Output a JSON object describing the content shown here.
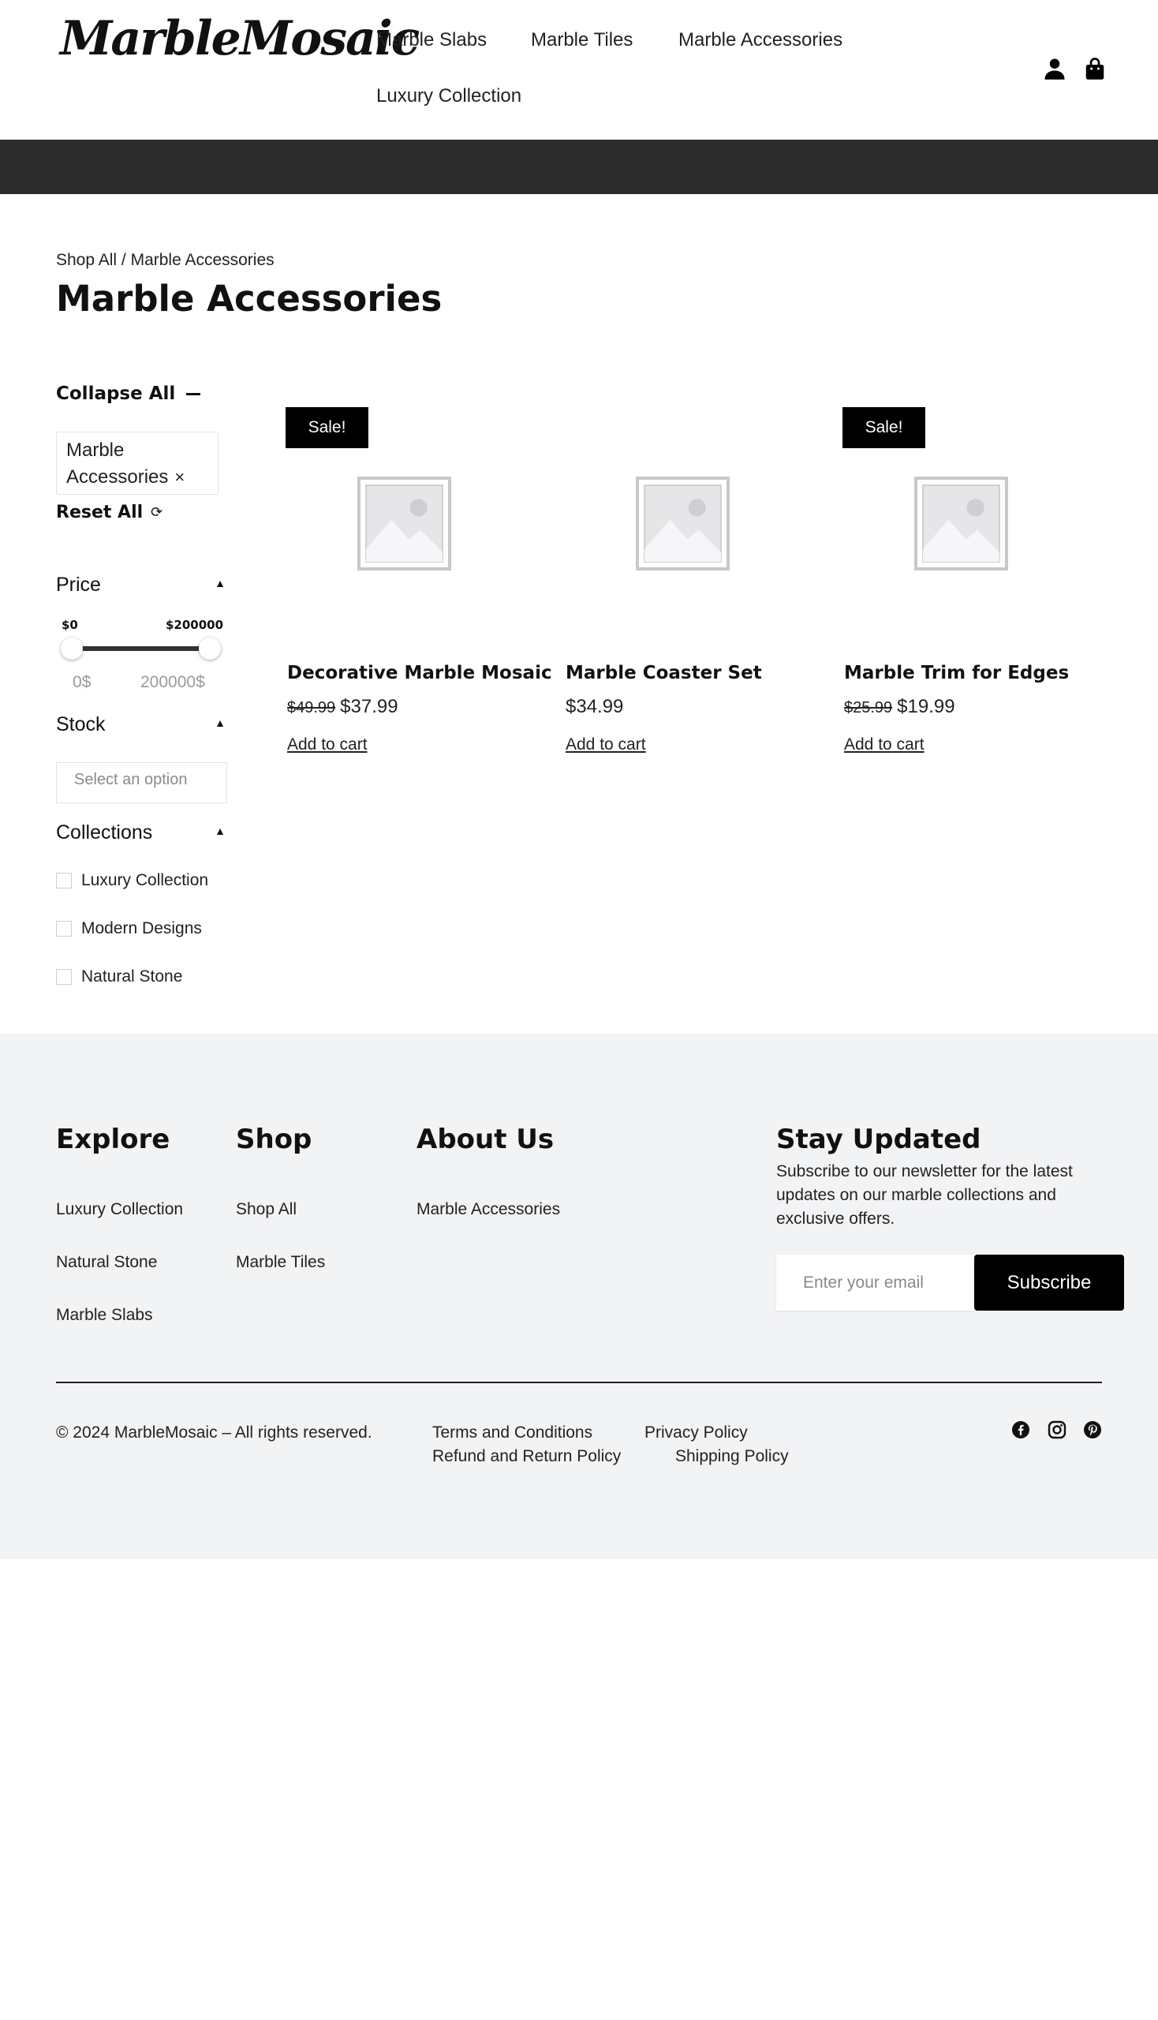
{
  "header": {
    "logo": "MarbleMosaic",
    "nav": [
      "Marble Slabs",
      "Marble Tiles",
      "Marble Accessories",
      "Luxury Collection"
    ],
    "icons": [
      "user-icon",
      "shopping-bag-icon"
    ]
  },
  "breadcrumb": {
    "root": "Shop All",
    "separator": " / ",
    "current": "Marble Accessories"
  },
  "page_title": "Marble Accessories",
  "sidebar": {
    "collapse_all": "Collapse All",
    "active_filter": "Marble Accessories",
    "remove_symbol": "×",
    "reset_all": "Reset All",
    "price": {
      "title": "Price",
      "min_label": "$0",
      "max_label": "$200000",
      "min_input": "0$",
      "max_input": "200000$",
      "range_min": 0,
      "range_max": 200000,
      "selected_min": 0,
      "selected_max": 200000
    },
    "stock": {
      "title": "Stock",
      "placeholder": "Select an option"
    },
    "collections": {
      "title": "Collections",
      "options": [
        "Luxury Collection",
        "Modern Designs",
        "Natural Stone"
      ]
    }
  },
  "products": [
    {
      "name": "Decorative Marble Mosaic",
      "badge": "Sale!",
      "old_price": "$49.99",
      "price": "$37.99",
      "action": "Add to cart"
    },
    {
      "name": "Marble Coaster Set",
      "badge": "",
      "old_price": "",
      "price": "$34.99",
      "action": "Add to cart"
    },
    {
      "name": "Marble Trim for Edges",
      "badge": "Sale!",
      "old_price": "$25.99",
      "price": "$19.99",
      "action": "Add to cart"
    }
  ],
  "footer": {
    "explore": {
      "title": "Explore",
      "links": [
        "Luxury Collection",
        "Natural Stone",
        "Marble Slabs"
      ]
    },
    "shop": {
      "title": "Shop",
      "links": [
        "Shop All",
        "Marble Tiles"
      ]
    },
    "about": {
      "title": "About Us",
      "links": [
        "Marble Accessories"
      ]
    },
    "newsletter": {
      "title": "Stay Updated",
      "text": "Subscribe to our newsletter for the latest updates on our marble collections and exclusive offers.",
      "placeholder": "Enter your email",
      "button": "Subscribe"
    },
    "copyright": "© 2024 MarbleMosaic – All rights reserved.",
    "legal_links": [
      "Terms and Conditions",
      "Privacy Policy",
      "Refund and Return Policy",
      "Shipping Policy"
    ],
    "social_icons": [
      "facebook-icon",
      "instagram-icon",
      "pinterest-icon"
    ]
  },
  "colors": {
    "dark_bar": "#2c2c2c",
    "footer_bg": "#f2f3f5",
    "badge_bg": "#000000",
    "button_bg": "#000000"
  }
}
